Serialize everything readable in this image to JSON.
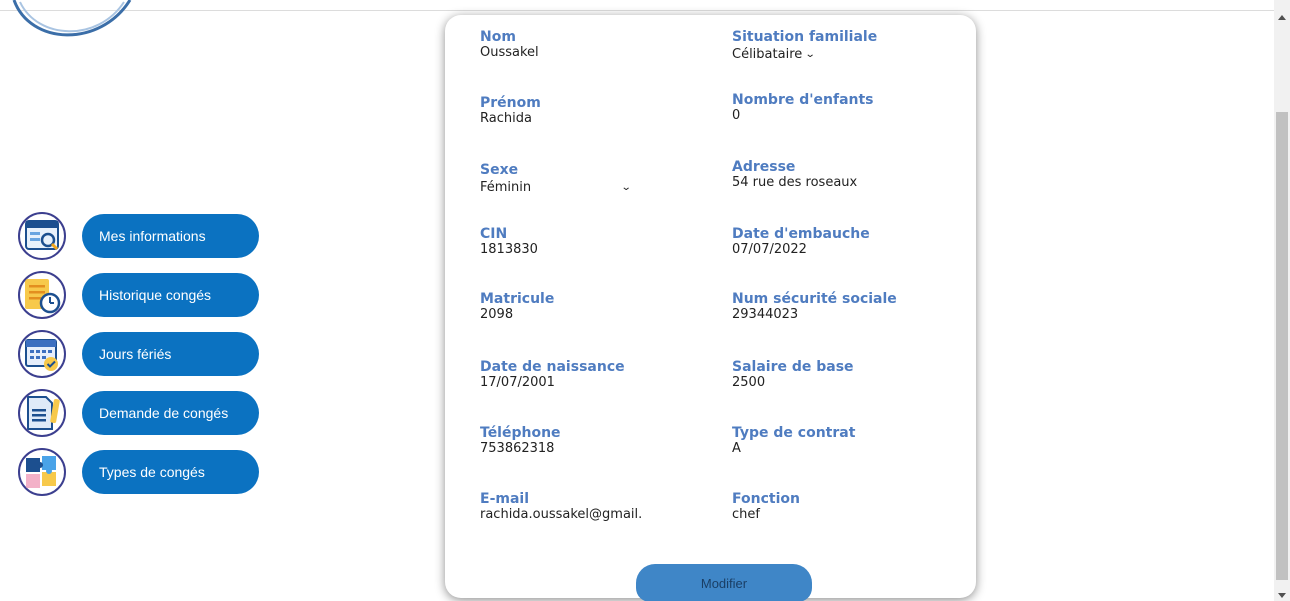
{
  "colors": {
    "accent": "#0b72c1",
    "label": "#4f7cc0",
    "button": "#3f86c7"
  },
  "sidebar": {
    "items": [
      {
        "label": "Mes informations",
        "icon": "profile-window-icon"
      },
      {
        "label": "Historique congés",
        "icon": "notes-clock-icon"
      },
      {
        "label": "Jours fériés",
        "icon": "calendar-check-icon"
      },
      {
        "label": "Demande de congés",
        "icon": "document-pen-icon"
      },
      {
        "label": "Types de congés",
        "icon": "puzzle-icon"
      }
    ]
  },
  "profile": {
    "nom": {
      "label": "Nom",
      "value": "Oussakel"
    },
    "situation": {
      "label": "Situation familiale",
      "value": "Célibataire"
    },
    "prenom": {
      "label": "Prénom",
      "value": "Rachida"
    },
    "enfants": {
      "label": "Nombre d'enfants",
      "value": "0"
    },
    "sexe": {
      "label": "Sexe",
      "value": "Féminin"
    },
    "adresse": {
      "label": "Adresse",
      "value": "54 rue des roseaux"
    },
    "cin": {
      "label": "CIN",
      "value": "1813830"
    },
    "embauche": {
      "label": "Date d'embauche",
      "value": "07/07/2022"
    },
    "matricule": {
      "label": "Matricule",
      "value": "2098"
    },
    "secu": {
      "label": "Num sécurité sociale",
      "value": "29344023"
    },
    "naissance": {
      "label": "Date de naissance",
      "value": "17/07/2001"
    },
    "salaire": {
      "label": "Salaire de base",
      "value": "2500"
    },
    "telephone": {
      "label": "Téléphone",
      "value": "753862318"
    },
    "contrat": {
      "label": "Type de contrat",
      "value": "A"
    },
    "email": {
      "label": "E-mail",
      "value": "rachida.oussakel@gmail."
    },
    "fonction": {
      "label": "Fonction",
      "value": "chef"
    }
  },
  "actions": {
    "modifier_label": "Modifier"
  }
}
